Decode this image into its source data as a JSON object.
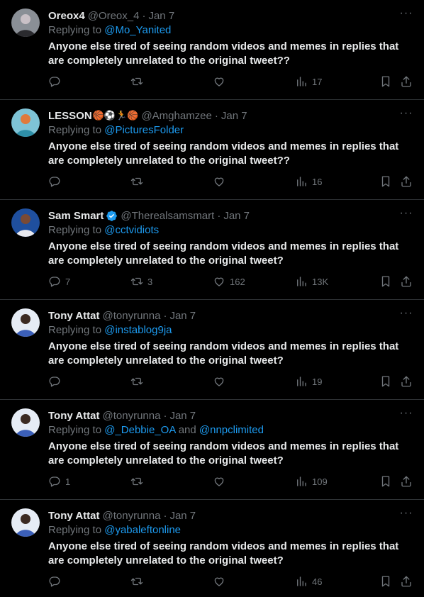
{
  "colors": {
    "background": "#000000",
    "text": "#e7e9ea",
    "muted": "#71767b",
    "link": "#1d9bf0",
    "divider": "#2f3336",
    "verified": "#1d9bf0"
  },
  "tweets": [
    {
      "name": "Oreox4",
      "emojis": "",
      "verified": false,
      "handle": "@Oreox_4",
      "sep": "·",
      "date": "Jan 7",
      "replying_label": "Replying to",
      "replying_to": "@Mo_Yanited",
      "replying_and": "",
      "replying_to2": "",
      "text": "Anyone else tired of seeing random videos and memes in replies that are completely unrelated to the original tweet??",
      "replies": "",
      "retweets": "",
      "likes": "",
      "views": "17",
      "avatar": {
        "bg": "#8a8f96",
        "fg": "#2a2a2e",
        "accent": "#c9c0c6"
      }
    },
    {
      "name": "LESSON",
      "emojis": "🏀⚽🏃🏀",
      "verified": false,
      "handle": "@Amghamzee",
      "sep": "·",
      "date": "Jan 7",
      "replying_label": "Replying to",
      "replying_to": "@PicturesFolder",
      "replying_and": "",
      "replying_to2": "",
      "text": "Anyone else tired of seeing random videos and memes in replies that are completely unrelated to the original tweet??",
      "replies": "",
      "retweets": "",
      "likes": "",
      "views": "16",
      "avatar": {
        "bg": "#7ec3d6",
        "fg": "#2e8fa8",
        "accent": "#e07a3c"
      }
    },
    {
      "name": "Sam Smart",
      "emojis": "",
      "verified": true,
      "handle": "@Therealsamsmart",
      "sep": "·",
      "date": "Jan 7",
      "replying_label": "Replying to",
      "replying_to": "@cctvidiots",
      "replying_and": "",
      "replying_to2": "",
      "text": "Anyone else tired of seeing random videos and memes in replies that are completely unrelated to the original tweet?",
      "replies": "7",
      "retweets": "3",
      "likes": "162",
      "views": "13K",
      "avatar": {
        "bg": "#1f4f9e",
        "fg": "#e8e8ee",
        "accent": "#7a4a35"
      }
    },
    {
      "name": "Tony Attat",
      "emojis": "",
      "verified": false,
      "handle": "@tonyrunna",
      "sep": "·",
      "date": "Jan 7",
      "replying_label": "Replying to",
      "replying_to": "@instablog9ja",
      "replying_and": "",
      "replying_to2": "",
      "text": "Anyone else tired of seeing random videos and memes in replies that are completely unrelated to the original tweet?",
      "replies": "",
      "retweets": "",
      "likes": "",
      "views": "19",
      "avatar": {
        "bg": "#e6ecf5",
        "fg": "#3b5fb8",
        "accent": "#3b2a22"
      }
    },
    {
      "name": "Tony Attat",
      "emojis": "",
      "verified": false,
      "handle": "@tonyrunna",
      "sep": "·",
      "date": "Jan 7",
      "replying_label": "Replying to",
      "replying_to": "@_Debbie_OA",
      "replying_and": "and",
      "replying_to2": "@nnpclimited",
      "text": "Anyone else tired of seeing random videos and memes in replies that are completely unrelated to the original tweet?",
      "replies": "1",
      "retweets": "",
      "likes": "",
      "views": "109",
      "avatar": {
        "bg": "#e6ecf5",
        "fg": "#3b5fb8",
        "accent": "#3b2a22"
      }
    },
    {
      "name": "Tony Attat",
      "emojis": "",
      "verified": false,
      "handle": "@tonyrunna",
      "sep": "·",
      "date": "Jan 7",
      "replying_label": "Replying to",
      "replying_to": "@yabaleftonline",
      "replying_and": "",
      "replying_to2": "",
      "text": "Anyone else tired of seeing random videos and memes in replies that are completely unrelated to the original tweet?",
      "replies": "",
      "retweets": "",
      "likes": "",
      "views": "46",
      "avatar": {
        "bg": "#e6ecf5",
        "fg": "#3b5fb8",
        "accent": "#3b2a22"
      }
    }
  ]
}
